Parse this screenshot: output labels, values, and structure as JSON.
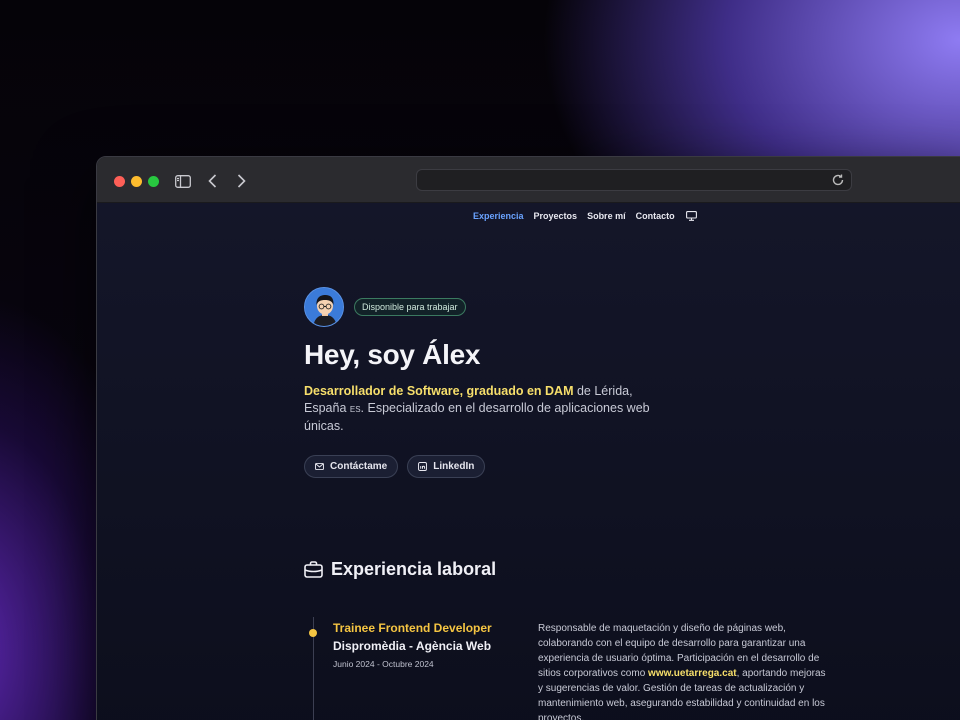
{
  "nav": {
    "items": [
      "Experiencia",
      "Proyectos",
      "Sobre mí",
      "Contacto"
    ],
    "active": "Experiencia",
    "theme_icon": "monitor-icon"
  },
  "hero": {
    "badge": "Disponible para trabajar",
    "title": "Hey, soy Álex",
    "lead_highlight": "Desarrollador de Software, graduado en DAM",
    "lead_part1": " de Lérida, España ",
    "lead_flag": "ES",
    "lead_part2": ". Especializado en el desarrollo de aplicaciones web únicas.",
    "buttons": [
      {
        "label": "Contáctame",
        "icon": "mail-icon"
      },
      {
        "label": "LinkedIn",
        "icon": "linkedin-icon"
      }
    ]
  },
  "experience": {
    "title": "Experiencia laboral",
    "icon": "briefcase-icon",
    "jobs": [
      {
        "role": "Trainee Frontend Developer",
        "company": "Dispromèdia - Agència Web",
        "dates": "Junio 2024 - Octubre 2024",
        "desc_part1": "Responsable de maquetación y diseño de páginas web, colaborando con el equipo de desarrollo para garantizar una experiencia de usuario óptima. Participación en el desarrollo de sitios corporativos como ",
        "desc_link": "www.uetarrega.cat",
        "desc_part2": ", aportando mejoras y sugerencias de valor. Gestión de tareas de actualización y mantenimiento web, asegurando estabilidad y continuidad en los proyectos."
      }
    ]
  },
  "colors": {
    "accent_nav": "#6aa3ff",
    "highlight": "#f7df6b",
    "timeline_dot": "#f5c542"
  }
}
